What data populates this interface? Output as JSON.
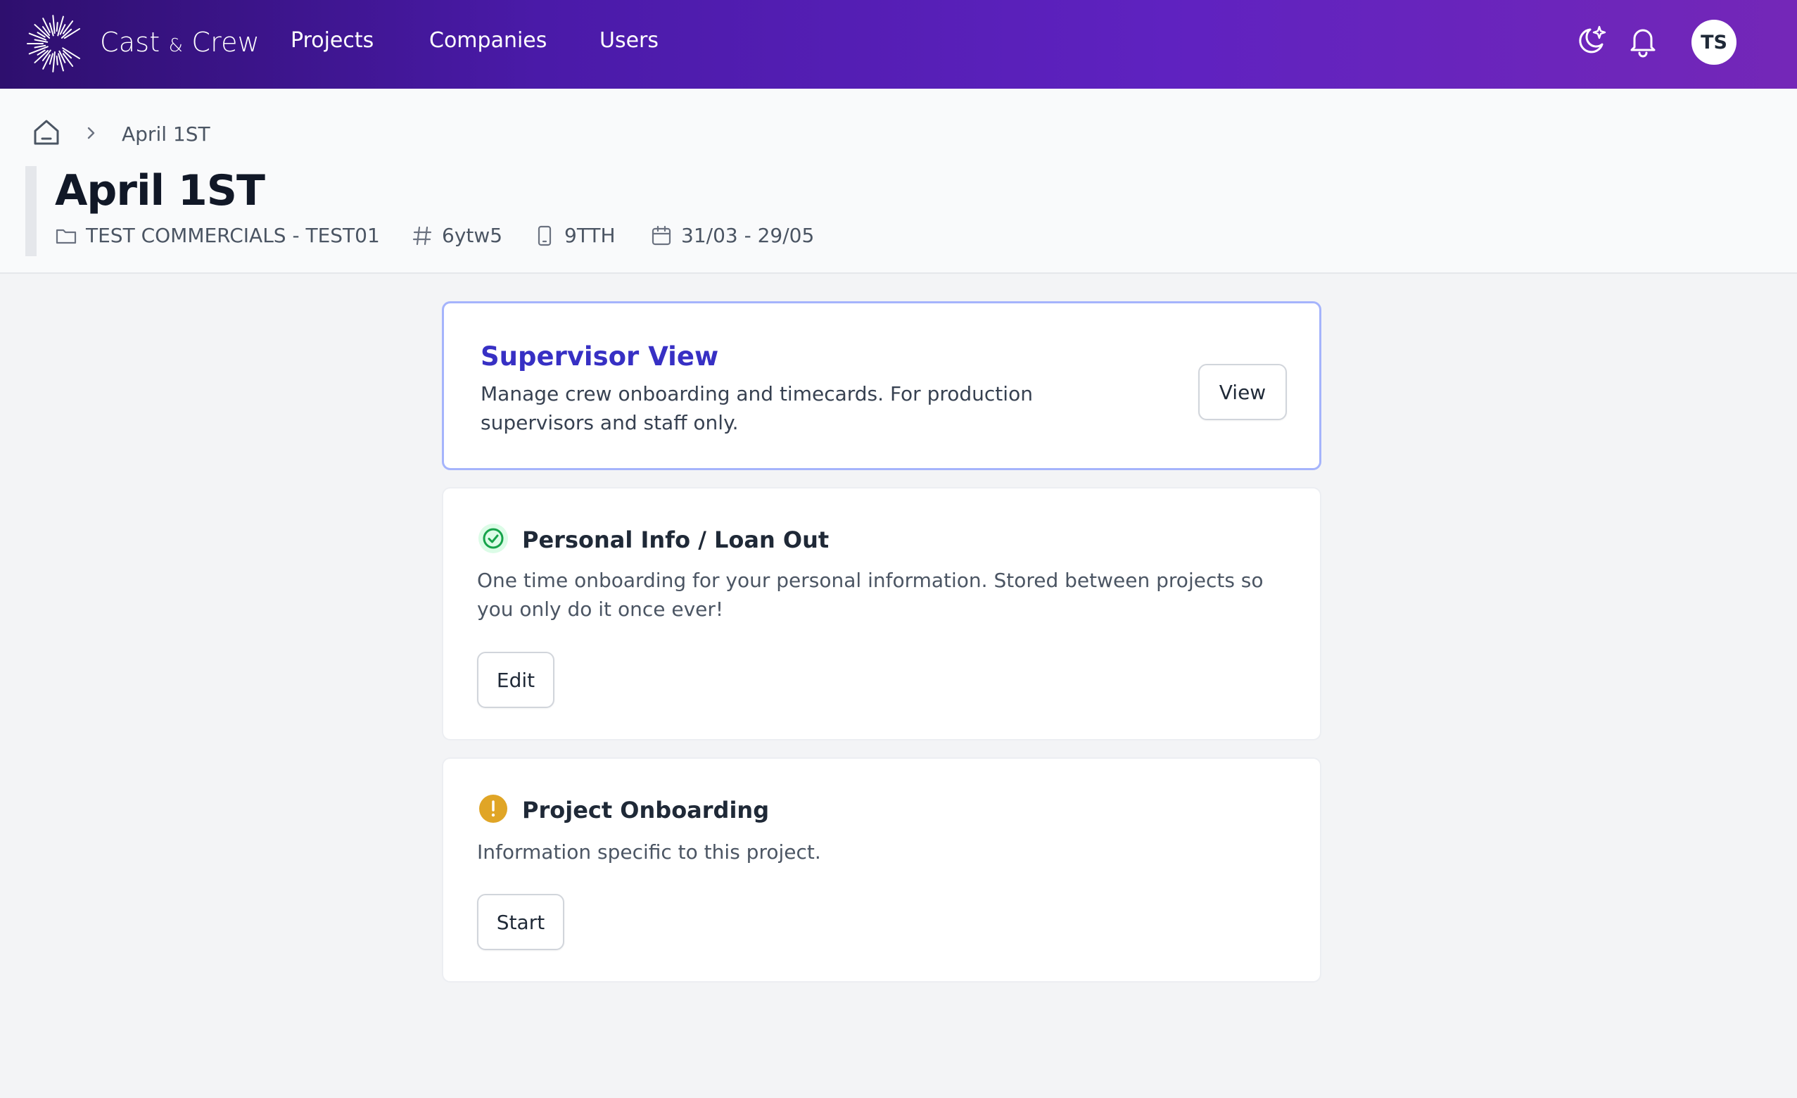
{
  "app": {
    "brand_main": "Cast",
    "brand_amp": "&",
    "brand_tail": "Crew",
    "accent": "#5b21b6"
  },
  "nav": {
    "links": [
      "Projects",
      "Companies",
      "Users"
    ],
    "icons": [
      "moon-sparkle-icon",
      "bell-icon"
    ],
    "avatar_initials": "TS"
  },
  "breadcrumb": {
    "current": "April 1ST"
  },
  "page": {
    "title": "April 1ST",
    "meta": {
      "company": "TEST COMMERCIALS - TEST01",
      "code": "6ytw5",
      "device": "9TTH",
      "dates": "31/03 - 29/05"
    }
  },
  "cards": {
    "supervisor": {
      "title": "Supervisor View",
      "description": "Manage crew onboarding and timecards. For production supervisors and staff only.",
      "button": "View"
    },
    "personal": {
      "title": "Personal Info / Loan Out",
      "description": "One time onboarding for your personal information. Stored between projects so you only do it once ever!",
      "button": "Edit",
      "status_color": "#16a34a"
    },
    "project": {
      "title": "Project Onboarding",
      "description": "Information specific to this project.",
      "button": "Start",
      "status_color": "#e0a526"
    }
  }
}
